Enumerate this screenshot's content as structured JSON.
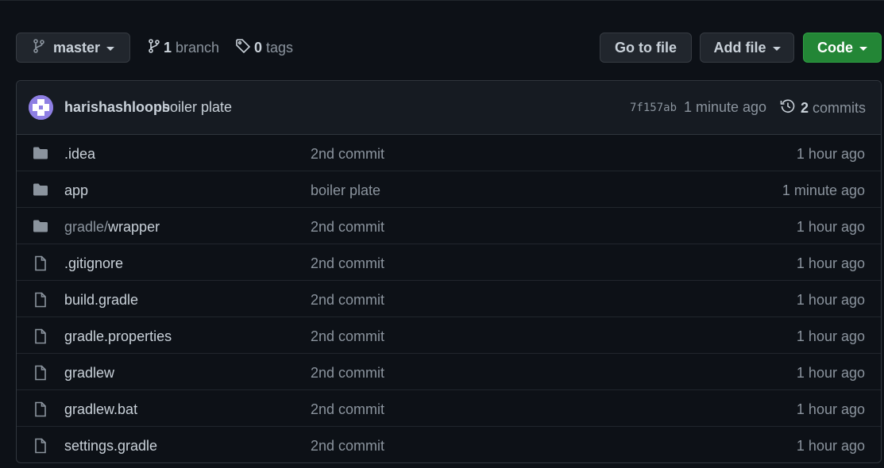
{
  "toolbar": {
    "branch_label": "master",
    "branch_count": "1",
    "branch_word": "branch",
    "tag_count": "0",
    "tag_word": "tags",
    "goto_file_label": "Go to file",
    "add_file_label": "Add file",
    "code_label": "Code"
  },
  "latest_commit": {
    "author": "harishashloops",
    "message": "boiler plate",
    "sha": "7f157ab",
    "time": "1 minute ago",
    "commit_count": "2",
    "commit_word": "commits"
  },
  "files": [
    {
      "type": "folder",
      "name_prefix": "",
      "name": ".idea",
      "commit": "2nd commit",
      "age": "1 hour ago"
    },
    {
      "type": "folder",
      "name_prefix": "",
      "name": "app",
      "commit": "boiler plate",
      "age": "1 minute ago"
    },
    {
      "type": "folder",
      "name_prefix": "gradle/",
      "name": "wrapper",
      "commit": "2nd commit",
      "age": "1 hour ago"
    },
    {
      "type": "file",
      "name_prefix": "",
      "name": ".gitignore",
      "commit": "2nd commit",
      "age": "1 hour ago"
    },
    {
      "type": "file",
      "name_prefix": "",
      "name": "build.gradle",
      "commit": "2nd commit",
      "age": "1 hour ago"
    },
    {
      "type": "file",
      "name_prefix": "",
      "name": "gradle.properties",
      "commit": "2nd commit",
      "age": "1 hour ago"
    },
    {
      "type": "file",
      "name_prefix": "",
      "name": "gradlew",
      "commit": "2nd commit",
      "age": "1 hour ago"
    },
    {
      "type": "file",
      "name_prefix": "",
      "name": "gradlew.bat",
      "commit": "2nd commit",
      "age": "1 hour ago"
    },
    {
      "type": "file",
      "name_prefix": "",
      "name": "settings.gradle",
      "commit": "2nd commit",
      "age": "1 hour ago"
    }
  ],
  "colors": {
    "background": "#0d1117",
    "header_bg": "#161b22",
    "border": "#30363d",
    "text": "#c9d1d9",
    "muted": "#8b949e",
    "primary_button": "#238636",
    "avatar": "#8e7fe3"
  },
  "icons": {
    "branch": "git-branch-icon",
    "tag": "tag-icon",
    "history": "history-icon",
    "folder": "folder-icon",
    "file": "file-icon"
  }
}
